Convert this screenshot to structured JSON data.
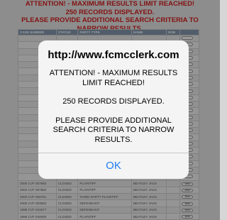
{
  "warning": {
    "line1": "ATTENTION! - MAXIMUM RESULTS LIMIT REACHED!",
    "line2": "250 RECORDS DISPLAYED.",
    "line3": "PLEASE PROVIDE ADDITIONAL SEARCH CRITERIA TO",
    "line4": "NARROW RESULTS."
  },
  "table": {
    "headers": [
      "CASE NUMBER",
      "STATUS",
      "PARTY TYPE",
      "NAME",
      "DOB",
      ""
    ],
    "view_label": "view",
    "rows": [
      [
        "",
        "",
        "",
        "",
        "",
        ""
      ],
      [
        "",
        "",
        "",
        "",
        "",
        ""
      ],
      [
        "",
        "",
        "",
        "",
        "",
        ""
      ],
      [
        "",
        "",
        "",
        "",
        "",
        ""
      ],
      [
        "",
        "",
        "",
        "",
        "",
        ""
      ],
      [
        "",
        "",
        "",
        "",
        "",
        ""
      ],
      [
        "",
        "",
        "",
        "",
        "",
        ""
      ],
      [
        "",
        "",
        "",
        "",
        "",
        ""
      ],
      [
        "",
        "",
        "",
        "",
        "",
        ""
      ],
      [
        "",
        "",
        "",
        "",
        "",
        ""
      ],
      [
        "",
        "",
        "",
        "",
        "",
        ""
      ],
      [
        "",
        "",
        "",
        "",
        "",
        ""
      ],
      [
        "",
        "",
        "",
        "",
        "",
        ""
      ],
      [
        "",
        "",
        "",
        "",
        "",
        ""
      ],
      [
        "",
        "",
        "",
        "",
        "",
        ""
      ],
      [
        "",
        "",
        "",
        "",
        "",
        ""
      ],
      [
        "",
        "",
        "",
        "",
        "",
        ""
      ],
      [
        "",
        "",
        "",
        "",
        "",
        ""
      ],
      [
        "",
        "",
        "",
        "",
        "",
        ""
      ],
      [
        "",
        "",
        "",
        "",
        "",
        ""
      ],
      [
        "",
        "",
        "",
        "",
        "",
        ""
      ],
      [
        "",
        "",
        "",
        "",
        "",
        ""
      ],
      [
        "2000 CVF 007583",
        "CLOSED",
        "PLAINTIFF",
        "BEATLEY JACK",
        "",
        "view"
      ],
      [
        "2000 CVF 007582",
        "CLOSED",
        "PLAINTIFF",
        "BEATLEY JACK",
        "",
        "view"
      ],
      [
        "2000 CVF 006751",
        "CLOSED",
        "THIRD PARTY PLAINTIFF",
        "BEATLEY JACK",
        "",
        "view"
      ],
      [
        "2000 CVF 003562",
        "CLOSED",
        "DEFENDANT",
        "BEATLEY JACK",
        "",
        "view"
      ],
      [
        "1998 CVF 041577",
        "CLOSED",
        "DEFENDANT",
        "BEATLEY JACK",
        "",
        "view"
      ],
      [
        "1998 CVF 040000",
        "CLOSED",
        "PLAINTIFF",
        "BEATLEY JACK",
        "",
        "view"
      ]
    ]
  },
  "alert": {
    "title": "http://www.fcmcclerk.com",
    "message1": "ATTENTION! - MAXIMUM RESULTS LIMIT REACHED!",
    "message2": "250 RECORDS DISPLAYED.",
    "message3": "PLEASE PROVIDE ADDITIONAL SEARCH CRITERIA TO NARROW RESULTS.",
    "ok_label": "OK",
    "accent_color": "#1e7cf6"
  }
}
